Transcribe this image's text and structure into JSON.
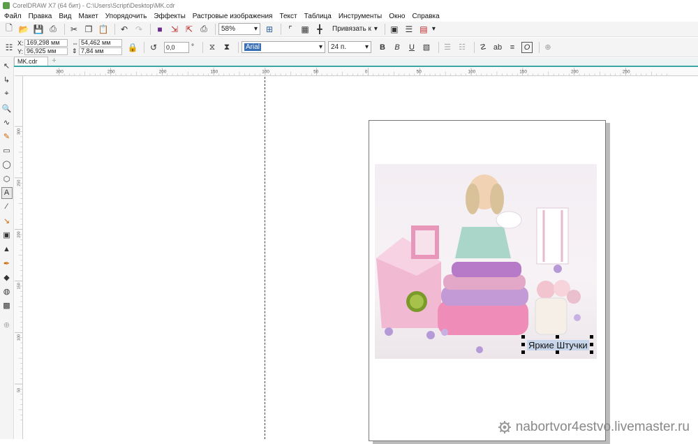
{
  "window": {
    "title": "CorelDRAW X7 (64 бит) - C:\\Users\\Script\\Desktop\\MK.cdr"
  },
  "menu": [
    "Файл",
    "Правка",
    "Вид",
    "Макет",
    "Упорядочить",
    "Эффекты",
    "Растровые изображения",
    "Текст",
    "Таблица",
    "Инструменты",
    "Окно",
    "Справка"
  ],
  "toolbar": {
    "zoom_value": "58%",
    "snap_label": "Привязать к"
  },
  "properties": {
    "x_label": "X:",
    "x_value": "169,298 мм",
    "y_label": "Y:",
    "y_value": "96,925 мм",
    "w_value": "54,462 мм",
    "h_value": "7,84 мм",
    "angle_value": "0,0",
    "angle_unit": "°",
    "font_name": "Arial",
    "font_size": "24 п."
  },
  "document_tab": {
    "name": "MK.cdr",
    "add_symbol": "+"
  },
  "ruler": {
    "h_ticks": [
      "300",
      "250",
      "200",
      "150",
      "100",
      "50",
      "0",
      "50",
      "100",
      "150",
      "200",
      "250"
    ],
    "v_ticks": [
      "300",
      "250",
      "200",
      "150",
      "100",
      "50"
    ]
  },
  "artwork_text": "Яркие Штучки",
  "watermark": "nabortvor4estvo.livemaster.ru",
  "colors": {
    "accent_tab": "#3aa6a6",
    "selection_fill": "#aac8eb",
    "photo_pink": "#f2a7c6",
    "photo_lilac": "#c5a6d9"
  }
}
